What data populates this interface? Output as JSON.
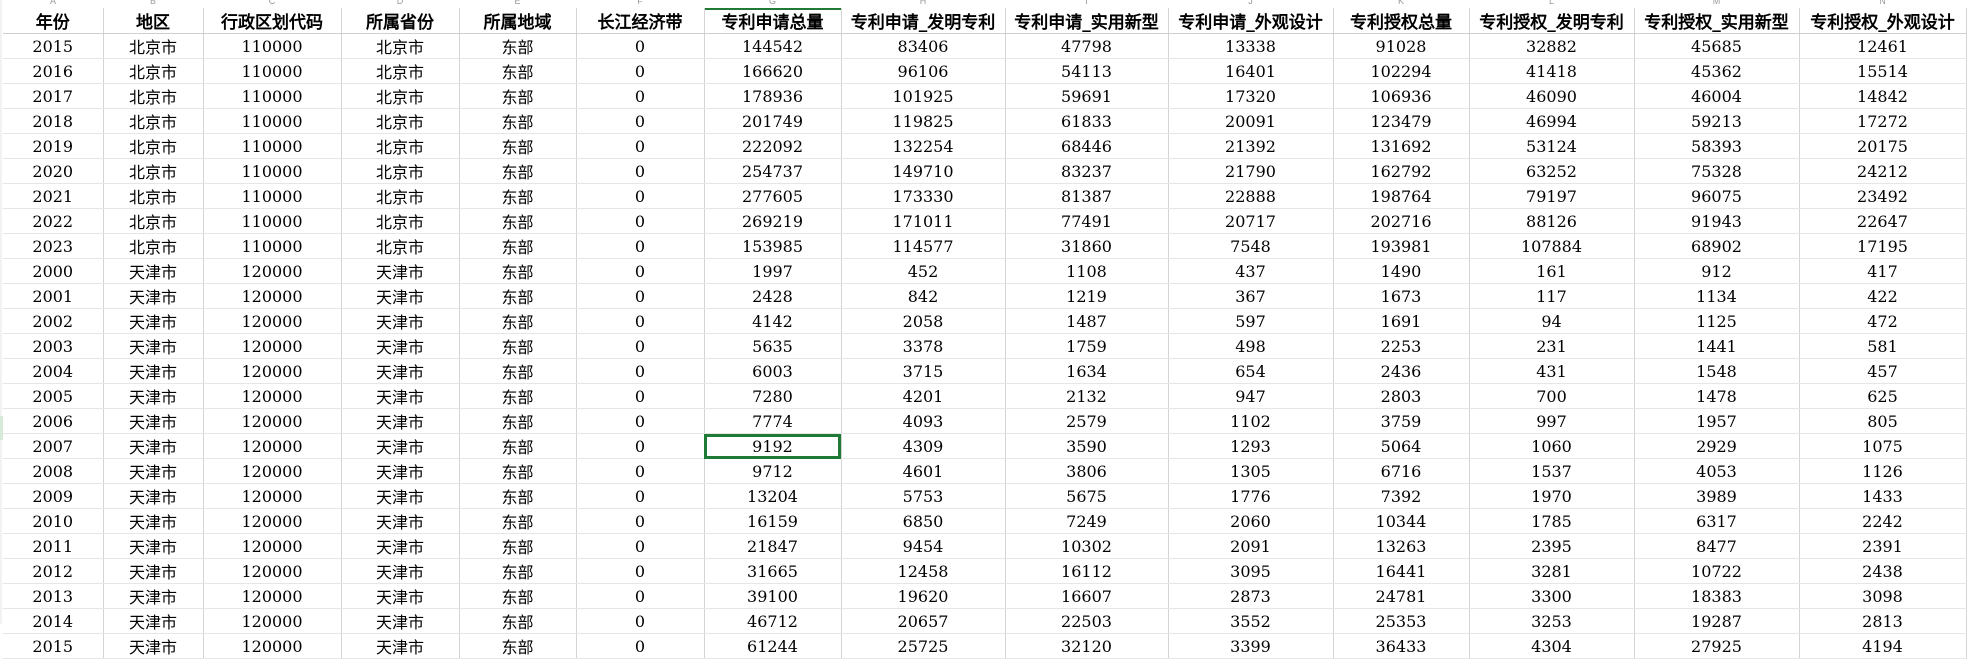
{
  "sheet": {
    "columns": [
      "年份",
      "地区",
      "行政区划代码",
      "所属省份",
      "所属地域",
      "长江经济带",
      "专利申请总量",
      "专利申请_发明专利",
      "专利申请_实用新型",
      "专利申请_外观设计",
      "专利授权总量",
      "专利授权_发明专利",
      "专利授权_实用新型",
      "专利授权_外观设计"
    ],
    "column_letters": [
      "A",
      "B",
      "C",
      "D",
      "E",
      "F",
      "G",
      "H",
      "I",
      "J",
      "K",
      "L",
      "M",
      "N"
    ],
    "rows": [
      [
        "2015",
        "北京市",
        "110000",
        "北京市",
        "东部",
        "0",
        "144542",
        "83406",
        "47798",
        "13338",
        "91028",
        "32882",
        "45685",
        "12461"
      ],
      [
        "2016",
        "北京市",
        "110000",
        "北京市",
        "东部",
        "0",
        "166620",
        "96106",
        "54113",
        "16401",
        "102294",
        "41418",
        "45362",
        "15514"
      ],
      [
        "2017",
        "北京市",
        "110000",
        "北京市",
        "东部",
        "0",
        "178936",
        "101925",
        "59691",
        "17320",
        "106936",
        "46090",
        "46004",
        "14842"
      ],
      [
        "2018",
        "北京市",
        "110000",
        "北京市",
        "东部",
        "0",
        "201749",
        "119825",
        "61833",
        "20091",
        "123479",
        "46994",
        "59213",
        "17272"
      ],
      [
        "2019",
        "北京市",
        "110000",
        "北京市",
        "东部",
        "0",
        "222092",
        "132254",
        "68446",
        "21392",
        "131692",
        "53124",
        "58393",
        "20175"
      ],
      [
        "2020",
        "北京市",
        "110000",
        "北京市",
        "东部",
        "0",
        "254737",
        "149710",
        "83237",
        "21790",
        "162792",
        "63252",
        "75328",
        "24212"
      ],
      [
        "2021",
        "北京市",
        "110000",
        "北京市",
        "东部",
        "0",
        "277605",
        "173330",
        "81387",
        "22888",
        "198764",
        "79197",
        "96075",
        "23492"
      ],
      [
        "2022",
        "北京市",
        "110000",
        "北京市",
        "东部",
        "0",
        "269219",
        "171011",
        "77491",
        "20717",
        "202716",
        "88126",
        "91943",
        "22647"
      ],
      [
        "2023",
        "北京市",
        "110000",
        "北京市",
        "东部",
        "0",
        "153985",
        "114577",
        "31860",
        "7548",
        "193981",
        "107884",
        "68902",
        "17195"
      ],
      [
        "2000",
        "天津市",
        "120000",
        "天津市",
        "东部",
        "0",
        "1997",
        "452",
        "1108",
        "437",
        "1490",
        "161",
        "912",
        "417"
      ],
      [
        "2001",
        "天津市",
        "120000",
        "天津市",
        "东部",
        "0",
        "2428",
        "842",
        "1219",
        "367",
        "1673",
        "117",
        "1134",
        "422"
      ],
      [
        "2002",
        "天津市",
        "120000",
        "天津市",
        "东部",
        "0",
        "4142",
        "2058",
        "1487",
        "597",
        "1691",
        "94",
        "1125",
        "472"
      ],
      [
        "2003",
        "天津市",
        "120000",
        "天津市",
        "东部",
        "0",
        "5635",
        "3378",
        "1759",
        "498",
        "2253",
        "231",
        "1441",
        "581"
      ],
      [
        "2004",
        "天津市",
        "120000",
        "天津市",
        "东部",
        "0",
        "6003",
        "3715",
        "1634",
        "654",
        "2436",
        "431",
        "1548",
        "457"
      ],
      [
        "2005",
        "天津市",
        "120000",
        "天津市",
        "东部",
        "0",
        "7280",
        "4201",
        "2132",
        "947",
        "2803",
        "700",
        "1478",
        "625"
      ],
      [
        "2006",
        "天津市",
        "120000",
        "天津市",
        "东部",
        "0",
        "7774",
        "4093",
        "2579",
        "1102",
        "3759",
        "997",
        "1957",
        "805"
      ],
      [
        "2007",
        "天津市",
        "120000",
        "天津市",
        "东部",
        "0",
        "9192",
        "4309",
        "3590",
        "1293",
        "5064",
        "1060",
        "2929",
        "1075"
      ],
      [
        "2008",
        "天津市",
        "120000",
        "天津市",
        "东部",
        "0",
        "9712",
        "4601",
        "3806",
        "1305",
        "6716",
        "1537",
        "4053",
        "1126"
      ],
      [
        "2009",
        "天津市",
        "120000",
        "天津市",
        "东部",
        "0",
        "13204",
        "5753",
        "5675",
        "1776",
        "7392",
        "1970",
        "3989",
        "1433"
      ],
      [
        "2010",
        "天津市",
        "120000",
        "天津市",
        "东部",
        "0",
        "16159",
        "6850",
        "7249",
        "2060",
        "10344",
        "1785",
        "6317",
        "2242"
      ],
      [
        "2011",
        "天津市",
        "120000",
        "天津市",
        "东部",
        "0",
        "21847",
        "9454",
        "10302",
        "2091",
        "13263",
        "2395",
        "8477",
        "2391"
      ],
      [
        "2012",
        "天津市",
        "120000",
        "天津市",
        "东部",
        "0",
        "31665",
        "12458",
        "16112",
        "3095",
        "16441",
        "3281",
        "10722",
        "2438"
      ],
      [
        "2013",
        "天津市",
        "120000",
        "天津市",
        "东部",
        "0",
        "39100",
        "19620",
        "16607",
        "2873",
        "24781",
        "3300",
        "18383",
        "3098"
      ],
      [
        "2014",
        "天津市",
        "120000",
        "天津市",
        "东部",
        "0",
        "46712",
        "20657",
        "22503",
        "3552",
        "25353",
        "3253",
        "19287",
        "2813"
      ],
      [
        "2015",
        "天津市",
        "120000",
        "天津市",
        "东部",
        "0",
        "61244",
        "25725",
        "32120",
        "3399",
        "36433",
        "4304",
        "27925",
        "4194"
      ]
    ],
    "selected_cell": {
      "row": 16,
      "col": 6
    },
    "accent_color": "#1e7a34"
  }
}
